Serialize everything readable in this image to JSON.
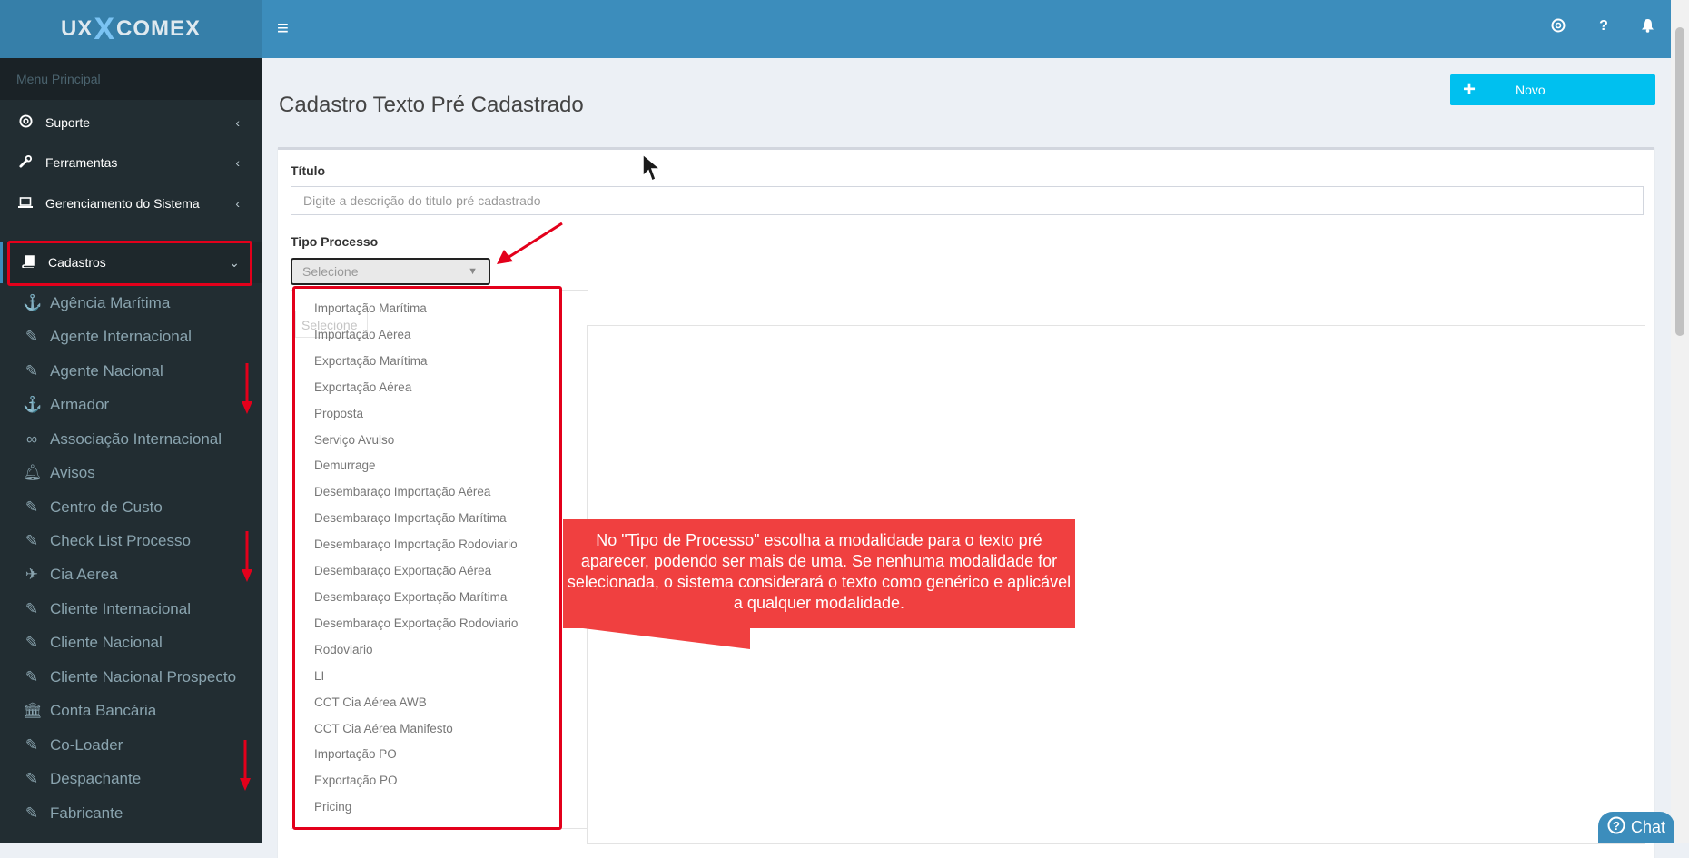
{
  "app": {
    "logo_left": "UX",
    "logo_x": "X",
    "logo_right": "COMEX"
  },
  "sidebar": {
    "menu_header": "Menu Principal",
    "items": [
      {
        "label": "Suporte",
        "icon": "lifebuoy-icon"
      },
      {
        "label": "Ferramentas",
        "icon": "wrench-icon"
      },
      {
        "label": "Gerenciamento do Sistema",
        "icon": "laptop-icon"
      },
      {
        "label": "Cadastros",
        "icon": "book-icon"
      }
    ],
    "sub_items": [
      {
        "label": "Agência Marítima",
        "icon": "anchor-icon"
      },
      {
        "label": "Agente Internacional",
        "icon": "edit-icon"
      },
      {
        "label": "Agente Nacional",
        "icon": "edit-icon"
      },
      {
        "label": "Armador",
        "icon": "anchor-icon"
      },
      {
        "label": "Associação Internacional",
        "icon": "link-icon"
      },
      {
        "label": "Avisos",
        "icon": "bell-icon"
      },
      {
        "label": "Centro de Custo",
        "icon": "edit-icon"
      },
      {
        "label": "Check List Processo",
        "icon": "edit-icon"
      },
      {
        "label": "Cia Aerea",
        "icon": "plane-icon"
      },
      {
        "label": "Cliente Internacional",
        "icon": "edit-icon"
      },
      {
        "label": "Cliente Nacional",
        "icon": "edit-icon"
      },
      {
        "label": "Cliente Nacional Prospecto",
        "icon": "edit-icon"
      },
      {
        "label": "Conta Bancária",
        "icon": "bank-icon"
      },
      {
        "label": "Co-Loader",
        "icon": "edit-icon"
      },
      {
        "label": "Despachante",
        "icon": "edit-icon"
      },
      {
        "label": "Fabricante",
        "icon": "edit-icon"
      }
    ]
  },
  "topbar": {
    "menu_icon": "hamburger-icon",
    "icons": [
      "lifebuoy-icon",
      "question-icon",
      "bell-icon"
    ],
    "question_glyph": "?"
  },
  "page": {
    "title": "Cadastro Texto Pré Cadastrado",
    "new_button": "Novo"
  },
  "form": {
    "titulo_label": "Título",
    "titulo_placeholder": "Digite a descrição do titulo pré cadastrado",
    "tipo_label": "Tipo Processo",
    "tipo_selected": "Selecione",
    "ghost_select": "Selecione",
    "tipo_options": [
      "Importação Marítima",
      "Importação Aérea",
      "Exportação Marítima",
      "Exportação Aérea",
      "Proposta",
      "Serviço Avulso",
      "Demurrage",
      "Desembaraço Importação Aérea",
      "Desembaraço Importação Marítima",
      "Desembaraço Importação Rodoviario",
      "Desembaraço Exportação Aérea",
      "Desembaraço Exportação Marítima",
      "Desembaraço Exportação Rodoviario",
      "Rodoviario",
      "LI",
      "CCT Cia Aérea AWB",
      "CCT Cia Aérea Manifesto",
      "Importação PO",
      "Exportação PO",
      "Pricing"
    ]
  },
  "callout": {
    "text": "No \"Tipo de Processo\" escolha a modalidade para o texto pré aparecer, podendo ser mais de uma. Se nenhuma modalidade for selecionada, o sistema considerará o texto como genérico e aplicável a qualquer modalidade."
  },
  "chat": {
    "label": "Chat"
  },
  "colors": {
    "sidebar": "#222d32",
    "topbar": "#3c8dbc",
    "accent": "#00c0ef",
    "annotation_red": "#e3001b",
    "callout_bg": "#f04040"
  }
}
